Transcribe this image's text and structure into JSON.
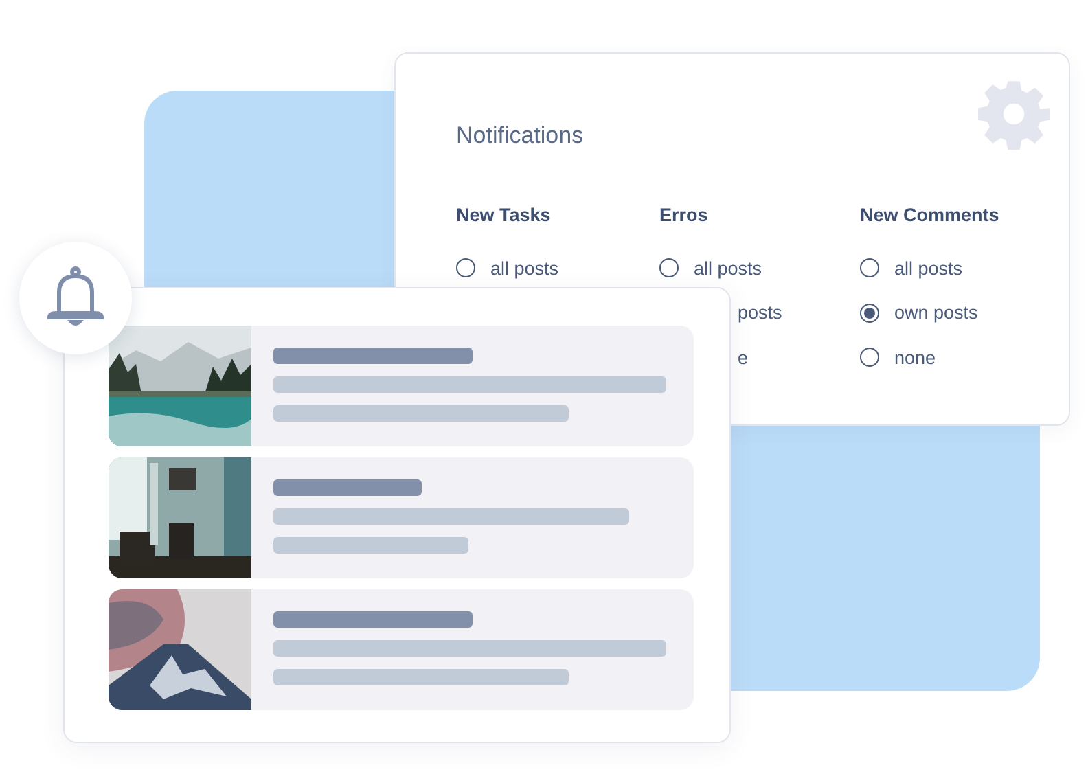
{
  "settings_panel": {
    "title": "Notifications",
    "columns": [
      {
        "heading": "New Tasks",
        "options": [
          {
            "label": "all posts",
            "selected": false
          }
        ]
      },
      {
        "heading": "Erros",
        "options": [
          {
            "label": "all posts",
            "selected": false
          },
          {
            "label": "posts"
          },
          {
            "label": "e"
          }
        ]
      },
      {
        "heading": "New Comments",
        "options": [
          {
            "label": "all posts",
            "selected": false
          },
          {
            "label": "own posts",
            "selected": true
          },
          {
            "label": "none",
            "selected": false
          }
        ]
      }
    ]
  },
  "feed": {
    "items": [
      {
        "kind": "lake"
      },
      {
        "kind": "interior"
      },
      {
        "kind": "volcano"
      }
    ]
  }
}
